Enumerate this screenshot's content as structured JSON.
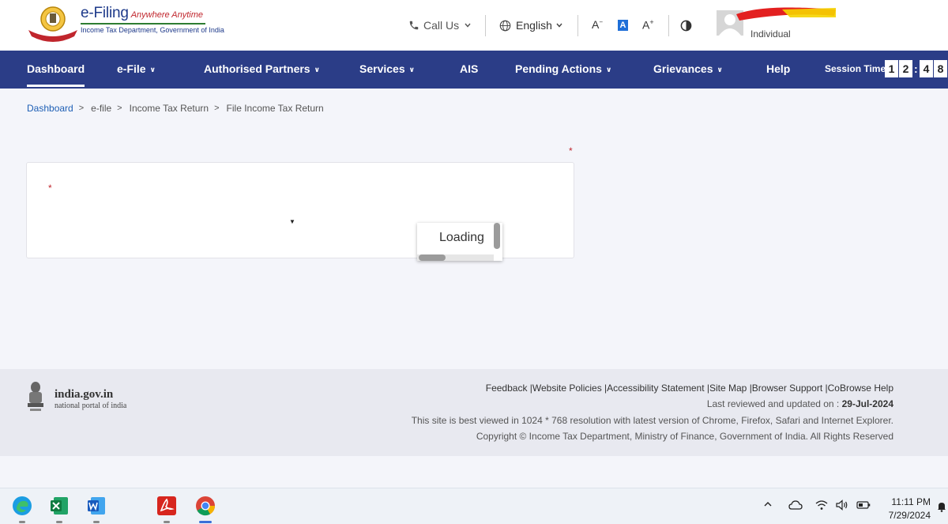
{
  "header": {
    "brand_main": "e-Filing",
    "brand_tagline": "Anywhere Anytime",
    "brand_sub": "Income Tax Department, Government of India",
    "call_us": "Call Us",
    "language": "English",
    "font_decrease": "A",
    "font_normal": "A",
    "font_increase": "A",
    "user_role": "Individual"
  },
  "nav": {
    "items": [
      {
        "label": "Dashboard",
        "dropdown": false,
        "active": true
      },
      {
        "label": "e-File",
        "dropdown": true
      },
      {
        "label": "Authorised Partners",
        "dropdown": true
      },
      {
        "label": "Services",
        "dropdown": true
      },
      {
        "label": "AIS",
        "dropdown": false
      },
      {
        "label": "Pending Actions",
        "dropdown": true
      },
      {
        "label": "Grievances",
        "dropdown": true
      },
      {
        "label": "Help",
        "dropdown": false
      }
    ],
    "session_label": "Session Time",
    "session_digits": [
      "1",
      "2",
      "4",
      "8"
    ],
    "session_colon": ":"
  },
  "breadcrumb": [
    "Dashboard",
    "e-file",
    "Income Tax Return",
    "File Income Tax Return"
  ],
  "form": {
    "required_mark": "*",
    "loading_text": "Loading"
  },
  "footer": {
    "gov_title": "india.gov.in",
    "gov_sub": "national portal of india",
    "links": "Feedback |Website Policies |Accessibility Statement |Site Map |Browser Support |CoBrowse Help",
    "reviewed_label": "Last reviewed and updated on :",
    "reviewed_date": "29-Jul-2024",
    "best_viewed": "This site is best viewed in 1024 * 768 resolution with latest version of Chrome, Firefox, Safari and Internet Explorer.",
    "copyright": "Copyright © Income Tax Department, Ministry of Finance, Government of India. All Rights Reserved"
  },
  "taskbar": {
    "apps": [
      "edge-icon",
      "excel-icon",
      "word-icon",
      "acrobat-icon",
      "chrome-icon"
    ],
    "time": "11:11 PM",
    "date": "7/29/2024"
  },
  "colors": {
    "nav_bg": "#2b3d87",
    "brand_blue": "#1e3a8a",
    "required_red": "#c0262d",
    "link_blue": "#1e5fb5"
  }
}
